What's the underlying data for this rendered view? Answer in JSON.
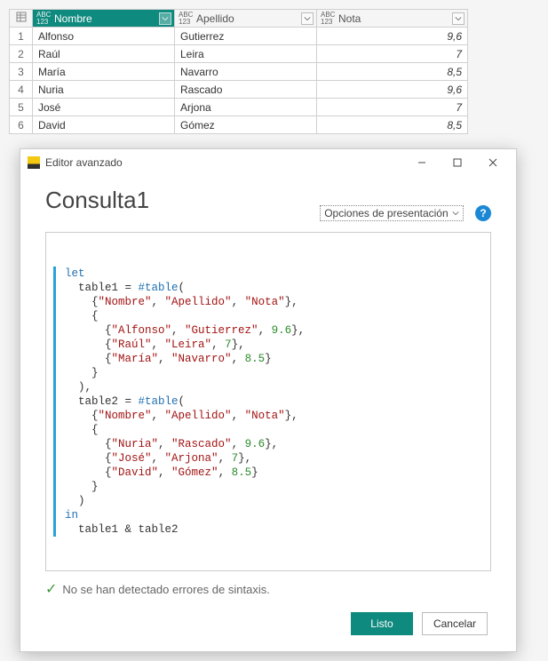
{
  "grid": {
    "type_badge": {
      "l1": "ABC",
      "l2": "123"
    },
    "columns": [
      {
        "label": "Nombre",
        "selected": true,
        "numeric": false
      },
      {
        "label": "Apellido",
        "selected": false,
        "numeric": false
      },
      {
        "label": "Nota",
        "selected": false,
        "numeric": true
      }
    ],
    "rows": [
      {
        "idx": "1",
        "cells": [
          "Alfonso",
          "Gutierrez",
          "9,6"
        ]
      },
      {
        "idx": "2",
        "cells": [
          "Raúl",
          "Leira",
          "7"
        ]
      },
      {
        "idx": "3",
        "cells": [
          "María",
          "Navarro",
          "8,5"
        ]
      },
      {
        "idx": "4",
        "cells": [
          "Nuria",
          "Rascado",
          "9,6"
        ]
      },
      {
        "idx": "5",
        "cells": [
          "José",
          "Arjona",
          "7"
        ]
      },
      {
        "idx": "6",
        "cells": [
          "David",
          "Gómez",
          "8,5"
        ]
      }
    ]
  },
  "dialog": {
    "window_title": "Editor avanzado",
    "heading": "Consulta1",
    "options_label": "Opciones de presentación",
    "help_symbol": "?",
    "status_text": "No se han detectado errores de sintaxis.",
    "buttons": {
      "ok": "Listo",
      "cancel": "Cancelar"
    },
    "code": {
      "kw_let": "let",
      "kw_in": "in",
      "table_fn": "#table",
      "var1": "table1",
      "var2": "table2",
      "cols": [
        "\"Nombre\"",
        "\"Apellido\"",
        "\"Nota\""
      ],
      "t1": [
        [
          "\"Alfonso\"",
          "\"Gutierrez\"",
          "9.6"
        ],
        [
          "\"Raúl\"",
          "\"Leira\"",
          "7"
        ],
        [
          "\"María\"",
          "\"Navarro\"",
          "8.5"
        ]
      ],
      "t2": [
        [
          "\"Nuria\"",
          "\"Rascado\"",
          "9.6"
        ],
        [
          "\"José\"",
          "\"Arjona\"",
          "7"
        ],
        [
          "\"David\"",
          "\"Gómez\"",
          "8.5"
        ]
      ],
      "result": "table1 & table2"
    }
  },
  "chart_data": {
    "type": "table",
    "columns": [
      "Nombre",
      "Apellido",
      "Nota"
    ],
    "rows": [
      [
        "Alfonso",
        "Gutierrez",
        9.6
      ],
      [
        "Raúl",
        "Leira",
        7
      ],
      [
        "María",
        "Navarro",
        8.5
      ],
      [
        "Nuria",
        "Rascado",
        9.6
      ],
      [
        "José",
        "Arjona",
        7
      ],
      [
        "David",
        "Gómez",
        8.5
      ]
    ]
  }
}
